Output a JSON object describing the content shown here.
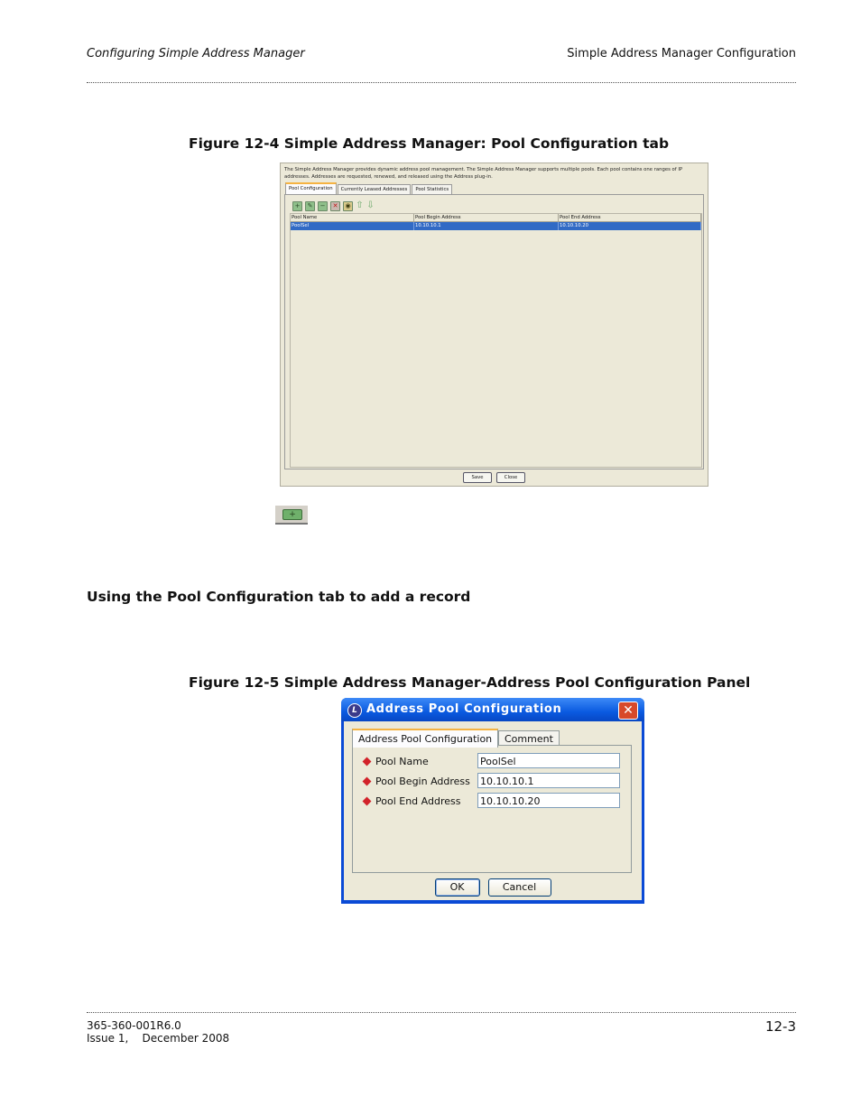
{
  "header": {
    "left": "Configuring Simple Address Manager",
    "right": "Simple Address Manager Configuration"
  },
  "figure1": {
    "caption": "Figure 12-4   Simple Address Manager: Pool Configuration tab",
    "intro_text": "The Simple Address Manager provides dynamic address pool management. The Simple Address Manager supports multiple pools. Each pool contains one ranges of IP addresses. Addresses are requested, renewed, and released using the Address plug-in.",
    "tabs": [
      "Pool Configuration",
      "Currently Leased Addresses",
      "Pool Statistics"
    ],
    "toolbar_icons": [
      "add-icon",
      "edit-icon",
      "remove-icon",
      "delete-icon",
      "save-icon",
      "move-up-icon",
      "move-down-icon"
    ],
    "table": {
      "columns": [
        "Pool Name",
        "Pool Begin Address",
        "Pool End Address"
      ],
      "rows": [
        {
          "name": "PoolSel",
          "begin": "10.10.10.1",
          "end": "10.10.10.20",
          "selected": true
        }
      ]
    },
    "buttons": {
      "save": "Save",
      "close": "Close"
    }
  },
  "add_button_icon": "add-record-icon",
  "section": {
    "title": "Using the Pool Configuration tab to add a record"
  },
  "figure2": {
    "caption": "Figure 12-5   Simple Address Manager-Address Pool Configuration Panel",
    "dialog": {
      "title": "Address Pool Configuration",
      "tabs": [
        "Address Pool Configuration",
        "Comment"
      ],
      "fields": [
        {
          "label": "Pool Name",
          "value": "PoolSel",
          "required": true
        },
        {
          "label": "Pool Begin Address",
          "value": "10.10.10.1",
          "required": true
        },
        {
          "label": "Pool End Address",
          "value": "10.10.10.20",
          "required": true
        }
      ],
      "ok": "OK",
      "cancel": "Cancel"
    }
  },
  "footer": {
    "doc_number": "365-360-001R6.0",
    "issue": "Issue 1,    December 2008",
    "page": "12-3"
  }
}
